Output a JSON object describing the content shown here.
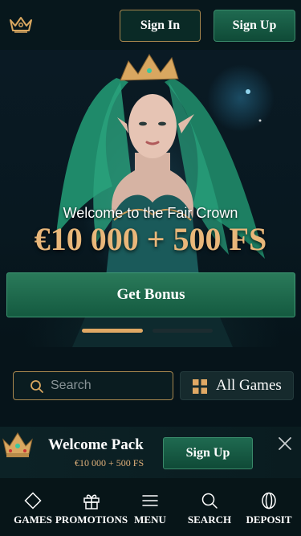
{
  "header": {
    "logo_icon": "crown-icon",
    "sign_in_label": "Sign In",
    "sign_up_label": "Sign Up"
  },
  "hero": {
    "subtitle": "Welcome to the Fair Crown",
    "amount": "€10 000 + 500 FS",
    "cta_label": "Get Bonus",
    "slides": 2,
    "active_slide": 1
  },
  "search": {
    "placeholder": "Search",
    "value": "",
    "all_games_label": "All Games"
  },
  "promo": {
    "title": "Welcome Pack",
    "subtitle": "€10 000 + 500 FS",
    "cta_label": "Sign Up"
  },
  "bottom_nav": {
    "items": [
      {
        "label": "GAMES",
        "icon": "diamond-icon"
      },
      {
        "label": "PROMOTIONS",
        "icon": "gift-icon"
      },
      {
        "label": "MENU",
        "icon": "menu-icon"
      },
      {
        "label": "SEARCH",
        "icon": "search-icon"
      },
      {
        "label": "DEPOSIT",
        "icon": "coin-icon"
      }
    ]
  },
  "colors": {
    "background": "#06141a",
    "accent_gold": "#e9b77a",
    "button_green": "#1a6a4e",
    "border_gold": "#a8874e"
  }
}
